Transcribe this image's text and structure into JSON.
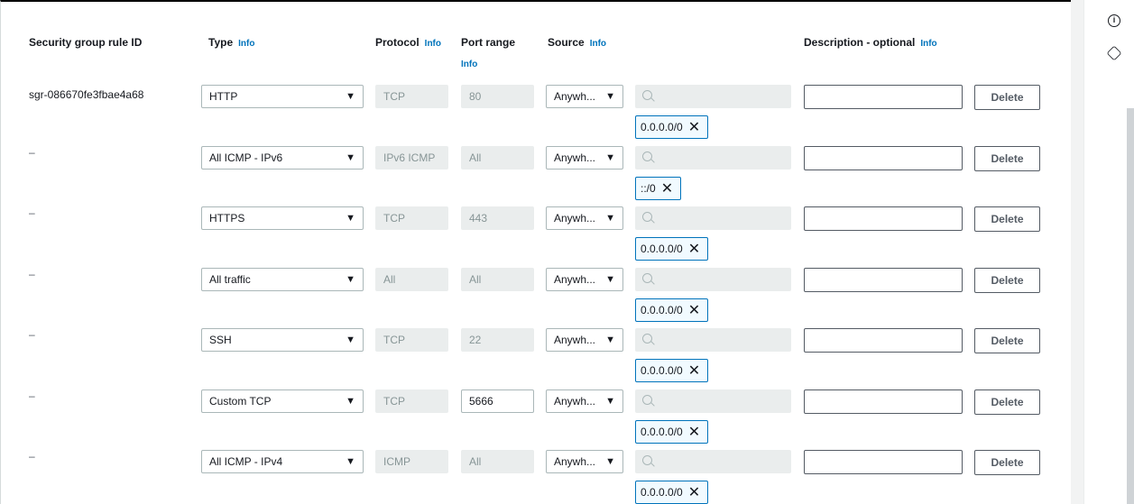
{
  "headers": {
    "rule_id": "Security group rule ID",
    "type": "Type",
    "type_info": "Info",
    "protocol": "Protocol",
    "protocol_info": "Info",
    "port_range": "Port range",
    "port_info": "Info",
    "source": "Source",
    "source_info": "Info",
    "description": "Description - optional",
    "description_info": "Info"
  },
  "rows": [
    {
      "id": "sgr-086670fe3fbae4a68",
      "type": "HTTP",
      "protocol": "TCP",
      "port": "80",
      "source": "Anywh...",
      "cidr": "0.0.0.0/0",
      "delete": "Delete"
    },
    {
      "id": "–",
      "type": "All ICMP - IPv6",
      "protocol": "IPv6 ICMP",
      "port": "All",
      "source": "Anywh...",
      "cidr": "::/0",
      "delete": "Delete"
    },
    {
      "id": "–",
      "type": "HTTPS",
      "protocol": "TCP",
      "port": "443",
      "source": "Anywh...",
      "cidr": "0.0.0.0/0",
      "delete": "Delete"
    },
    {
      "id": "–",
      "type": "All traffic",
      "protocol": "All",
      "port": "All",
      "source": "Anywh...",
      "cidr": "0.0.0.0/0",
      "delete": "Delete"
    },
    {
      "id": "–",
      "type": "SSH",
      "protocol": "TCP",
      "port": "22",
      "source": "Anywh...",
      "cidr": "0.0.0.0/0",
      "delete": "Delete"
    },
    {
      "id": "–",
      "type": "Custom TCP",
      "protocol": "TCP",
      "port": "5666",
      "source": "Anywh...",
      "cidr": "0.0.0.0/0",
      "delete": "Delete"
    },
    {
      "id": "–",
      "type": "All ICMP - IPv4",
      "protocol": "ICMP",
      "port": "All",
      "source": "Anywh...",
      "cidr": "0.0.0.0/0",
      "delete": "Delete"
    }
  ],
  "icons": {
    "rail_top": "info-circle-icon",
    "rail_second": "settings-hex-icon",
    "dropdown": "caret-down-icon",
    "search": "search-icon",
    "remove": "close-icon"
  },
  "colors": {
    "link": "#0073bb",
    "token_border": "#0073bb",
    "disabled_bg": "#eaeded"
  }
}
